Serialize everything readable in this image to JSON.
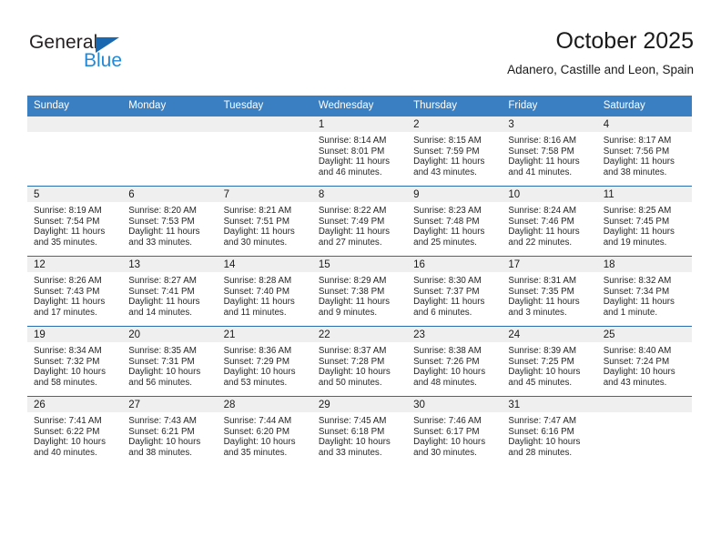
{
  "brand": {
    "name_top": "General",
    "name_bottom": "Blue",
    "accent_color": "#2389d6",
    "triangle_color": "#1a69b0"
  },
  "header": {
    "title": "October 2025",
    "subtitle": "Adanero, Castille and Leon, Spain"
  },
  "theme": {
    "header_row_bg": "#3a7fc1",
    "row_divider": "#2a6cad",
    "daynum_band_bg": "#efefef"
  },
  "calendar": {
    "weekday_headers": [
      "Sunday",
      "Monday",
      "Tuesday",
      "Wednesday",
      "Thursday",
      "Friday",
      "Saturday"
    ],
    "weeks": [
      [
        {
          "day": "",
          "empty": true,
          "sunrise": "",
          "sunset": "",
          "daylight_line1": "",
          "daylight_line2": ""
        },
        {
          "day": "",
          "empty": true,
          "sunrise": "",
          "sunset": "",
          "daylight_line1": "",
          "daylight_line2": ""
        },
        {
          "day": "",
          "empty": true,
          "sunrise": "",
          "sunset": "",
          "daylight_line1": "",
          "daylight_line2": ""
        },
        {
          "day": "1",
          "empty": false,
          "sunrise": "Sunrise: 8:14 AM",
          "sunset": "Sunset: 8:01 PM",
          "daylight_line1": "Daylight: 11 hours",
          "daylight_line2": "and 46 minutes."
        },
        {
          "day": "2",
          "empty": false,
          "sunrise": "Sunrise: 8:15 AM",
          "sunset": "Sunset: 7:59 PM",
          "daylight_line1": "Daylight: 11 hours",
          "daylight_line2": "and 43 minutes."
        },
        {
          "day": "3",
          "empty": false,
          "sunrise": "Sunrise: 8:16 AM",
          "sunset": "Sunset: 7:58 PM",
          "daylight_line1": "Daylight: 11 hours",
          "daylight_line2": "and 41 minutes."
        },
        {
          "day": "4",
          "empty": false,
          "sunrise": "Sunrise: 8:17 AM",
          "sunset": "Sunset: 7:56 PM",
          "daylight_line1": "Daylight: 11 hours",
          "daylight_line2": "and 38 minutes."
        }
      ],
      [
        {
          "day": "5",
          "empty": false,
          "sunrise": "Sunrise: 8:19 AM",
          "sunset": "Sunset: 7:54 PM",
          "daylight_line1": "Daylight: 11 hours",
          "daylight_line2": "and 35 minutes."
        },
        {
          "day": "6",
          "empty": false,
          "sunrise": "Sunrise: 8:20 AM",
          "sunset": "Sunset: 7:53 PM",
          "daylight_line1": "Daylight: 11 hours",
          "daylight_line2": "and 33 minutes."
        },
        {
          "day": "7",
          "empty": false,
          "sunrise": "Sunrise: 8:21 AM",
          "sunset": "Sunset: 7:51 PM",
          "daylight_line1": "Daylight: 11 hours",
          "daylight_line2": "and 30 minutes."
        },
        {
          "day": "8",
          "empty": false,
          "sunrise": "Sunrise: 8:22 AM",
          "sunset": "Sunset: 7:49 PM",
          "daylight_line1": "Daylight: 11 hours",
          "daylight_line2": "and 27 minutes."
        },
        {
          "day": "9",
          "empty": false,
          "sunrise": "Sunrise: 8:23 AM",
          "sunset": "Sunset: 7:48 PM",
          "daylight_line1": "Daylight: 11 hours",
          "daylight_line2": "and 25 minutes."
        },
        {
          "day": "10",
          "empty": false,
          "sunrise": "Sunrise: 8:24 AM",
          "sunset": "Sunset: 7:46 PM",
          "daylight_line1": "Daylight: 11 hours",
          "daylight_line2": "and 22 minutes."
        },
        {
          "day": "11",
          "empty": false,
          "sunrise": "Sunrise: 8:25 AM",
          "sunset": "Sunset: 7:45 PM",
          "daylight_line1": "Daylight: 11 hours",
          "daylight_line2": "and 19 minutes."
        }
      ],
      [
        {
          "day": "12",
          "empty": false,
          "sunrise": "Sunrise: 8:26 AM",
          "sunset": "Sunset: 7:43 PM",
          "daylight_line1": "Daylight: 11 hours",
          "daylight_line2": "and 17 minutes."
        },
        {
          "day": "13",
          "empty": false,
          "sunrise": "Sunrise: 8:27 AM",
          "sunset": "Sunset: 7:41 PM",
          "daylight_line1": "Daylight: 11 hours",
          "daylight_line2": "and 14 minutes."
        },
        {
          "day": "14",
          "empty": false,
          "sunrise": "Sunrise: 8:28 AM",
          "sunset": "Sunset: 7:40 PM",
          "daylight_line1": "Daylight: 11 hours",
          "daylight_line2": "and 11 minutes."
        },
        {
          "day": "15",
          "empty": false,
          "sunrise": "Sunrise: 8:29 AM",
          "sunset": "Sunset: 7:38 PM",
          "daylight_line1": "Daylight: 11 hours",
          "daylight_line2": "and 9 minutes."
        },
        {
          "day": "16",
          "empty": false,
          "sunrise": "Sunrise: 8:30 AM",
          "sunset": "Sunset: 7:37 PM",
          "daylight_line1": "Daylight: 11 hours",
          "daylight_line2": "and 6 minutes."
        },
        {
          "day": "17",
          "empty": false,
          "sunrise": "Sunrise: 8:31 AM",
          "sunset": "Sunset: 7:35 PM",
          "daylight_line1": "Daylight: 11 hours",
          "daylight_line2": "and 3 minutes."
        },
        {
          "day": "18",
          "empty": false,
          "sunrise": "Sunrise: 8:32 AM",
          "sunset": "Sunset: 7:34 PM",
          "daylight_line1": "Daylight: 11 hours",
          "daylight_line2": "and 1 minute."
        }
      ],
      [
        {
          "day": "19",
          "empty": false,
          "sunrise": "Sunrise: 8:34 AM",
          "sunset": "Sunset: 7:32 PM",
          "daylight_line1": "Daylight: 10 hours",
          "daylight_line2": "and 58 minutes."
        },
        {
          "day": "20",
          "empty": false,
          "sunrise": "Sunrise: 8:35 AM",
          "sunset": "Sunset: 7:31 PM",
          "daylight_line1": "Daylight: 10 hours",
          "daylight_line2": "and 56 minutes."
        },
        {
          "day": "21",
          "empty": false,
          "sunrise": "Sunrise: 8:36 AM",
          "sunset": "Sunset: 7:29 PM",
          "daylight_line1": "Daylight: 10 hours",
          "daylight_line2": "and 53 minutes."
        },
        {
          "day": "22",
          "empty": false,
          "sunrise": "Sunrise: 8:37 AM",
          "sunset": "Sunset: 7:28 PM",
          "daylight_line1": "Daylight: 10 hours",
          "daylight_line2": "and 50 minutes."
        },
        {
          "day": "23",
          "empty": false,
          "sunrise": "Sunrise: 8:38 AM",
          "sunset": "Sunset: 7:26 PM",
          "daylight_line1": "Daylight: 10 hours",
          "daylight_line2": "and 48 minutes."
        },
        {
          "day": "24",
          "empty": false,
          "sunrise": "Sunrise: 8:39 AM",
          "sunset": "Sunset: 7:25 PM",
          "daylight_line1": "Daylight: 10 hours",
          "daylight_line2": "and 45 minutes."
        },
        {
          "day": "25",
          "empty": false,
          "sunrise": "Sunrise: 8:40 AM",
          "sunset": "Sunset: 7:24 PM",
          "daylight_line1": "Daylight: 10 hours",
          "daylight_line2": "and 43 minutes."
        }
      ],
      [
        {
          "day": "26",
          "empty": false,
          "sunrise": "Sunrise: 7:41 AM",
          "sunset": "Sunset: 6:22 PM",
          "daylight_line1": "Daylight: 10 hours",
          "daylight_line2": "and 40 minutes."
        },
        {
          "day": "27",
          "empty": false,
          "sunrise": "Sunrise: 7:43 AM",
          "sunset": "Sunset: 6:21 PM",
          "daylight_line1": "Daylight: 10 hours",
          "daylight_line2": "and 38 minutes."
        },
        {
          "day": "28",
          "empty": false,
          "sunrise": "Sunrise: 7:44 AM",
          "sunset": "Sunset: 6:20 PM",
          "daylight_line1": "Daylight: 10 hours",
          "daylight_line2": "and 35 minutes."
        },
        {
          "day": "29",
          "empty": false,
          "sunrise": "Sunrise: 7:45 AM",
          "sunset": "Sunset: 6:18 PM",
          "daylight_line1": "Daylight: 10 hours",
          "daylight_line2": "and 33 minutes."
        },
        {
          "day": "30",
          "empty": false,
          "sunrise": "Sunrise: 7:46 AM",
          "sunset": "Sunset: 6:17 PM",
          "daylight_line1": "Daylight: 10 hours",
          "daylight_line2": "and 30 minutes."
        },
        {
          "day": "31",
          "empty": false,
          "sunrise": "Sunrise: 7:47 AM",
          "sunset": "Sunset: 6:16 PM",
          "daylight_line1": "Daylight: 10 hours",
          "daylight_line2": "and 28 minutes."
        },
        {
          "day": "",
          "empty": true,
          "sunrise": "",
          "sunset": "",
          "daylight_line1": "",
          "daylight_line2": ""
        }
      ]
    ]
  }
}
